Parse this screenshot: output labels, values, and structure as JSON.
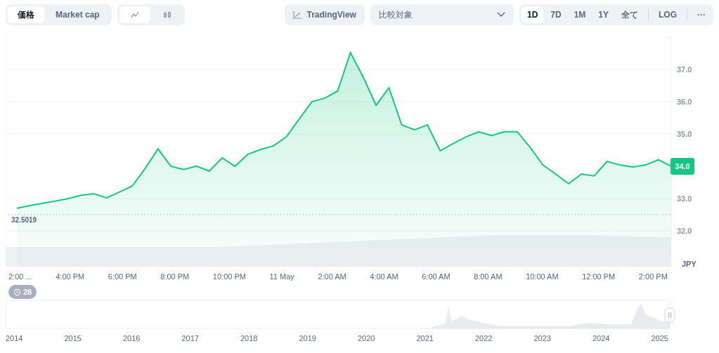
{
  "price_tabs": [
    {
      "label": "価格",
      "selected": true
    },
    {
      "label": "Market cap",
      "selected": false
    }
  ],
  "chart_type": [
    {
      "kind": "line",
      "selected": true
    },
    {
      "kind": "candle",
      "selected": false
    }
  ],
  "tradingview_button": "TradingView",
  "compare_select": {
    "placeholder": "比較対象"
  },
  "range_tabs": [
    {
      "label": "1D",
      "selected": true
    },
    {
      "label": "7D",
      "selected": false
    },
    {
      "label": "1M",
      "selected": false
    },
    {
      "label": "1Y",
      "selected": false
    },
    {
      "label": "全て",
      "selected": false
    }
  ],
  "log_button": "LOG",
  "more_button": "···",
  "price_chart": {
    "current_price": "34.0",
    "currency": "JPY",
    "x_labels": [
      "2:00 ...",
      "4:00 PM",
      "6:00 PM",
      "8:00 PM",
      "10:00 PM",
      "11 May",
      "2:00 AM",
      "4:00 AM",
      "6:00 AM",
      "8:00 AM",
      "10:00 AM",
      "12:00 PM",
      "2:00 PM"
    ],
    "chart_data": {
      "type": "area",
      "grid": true,
      "ylim": [
        30.89,
        38.02
      ],
      "yticks": [
        {
          "value": 32,
          "label": "32.0"
        },
        {
          "value": 33,
          "label": "33.0"
        },
        {
          "value": 35,
          "label": "35.0"
        },
        {
          "value": 36,
          "label": "36.0"
        },
        {
          "value": 37,
          "label": "37.0"
        }
      ],
      "ref_lines": [
        {
          "axis": "y",
          "value": 32.5019,
          "label": "32.5019"
        }
      ],
      "series": [
        {
          "color": "#16c784",
          "values": [
            32.7,
            32.78,
            32.85,
            32.92,
            33.0,
            33.1,
            33.15,
            33.02,
            33.2,
            33.39,
            33.93,
            34.54,
            34.0,
            33.9,
            34.0,
            33.85,
            34.26,
            34.0,
            34.37,
            34.52,
            34.63,
            34.91,
            35.46,
            36.0,
            36.11,
            36.33,
            37.52,
            36.76,
            35.89,
            36.43,
            35.28,
            35.13,
            35.28,
            34.48,
            34.7,
            34.91,
            35.07,
            34.95,
            35.07,
            35.07,
            34.59,
            34.04,
            33.76,
            33.46,
            33.76,
            33.7,
            34.15,
            34.04,
            33.98,
            34.04,
            34.2,
            34.0
          ]
        }
      ]
    }
  },
  "history_badge": "28",
  "navigator": {
    "years": [
      "2014",
      "2015",
      "2016",
      "2017",
      "2018",
      "2019",
      "2020",
      "2021",
      "2022",
      "2023",
      "2024",
      "2025"
    ]
  }
}
